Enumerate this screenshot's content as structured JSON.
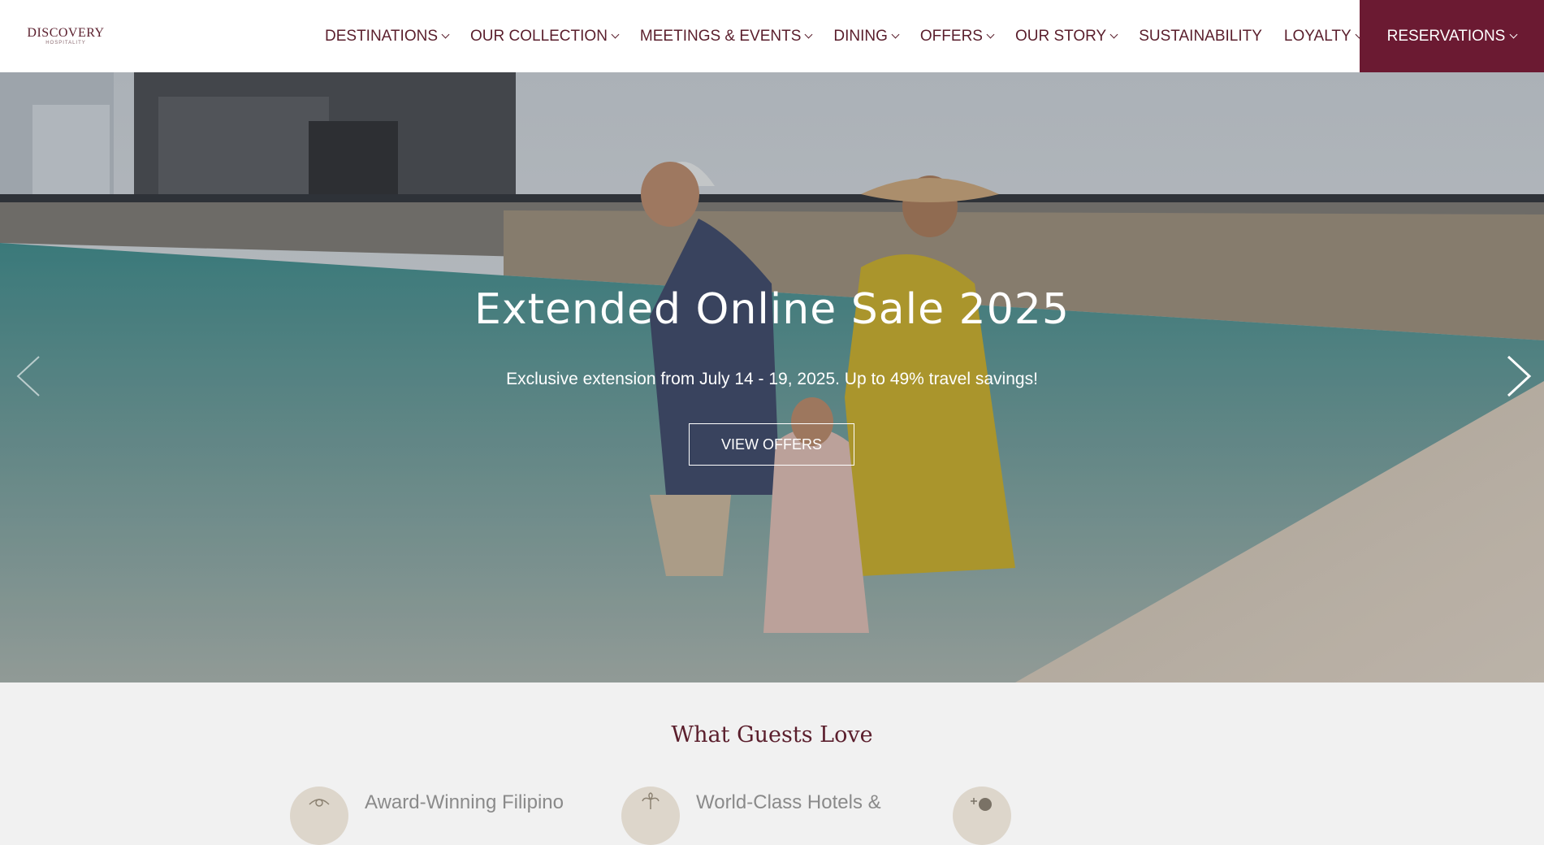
{
  "header": {
    "logo": {
      "main": "DISCOVERY",
      "sub": "HOSPITALITY"
    },
    "nav": [
      {
        "label": "DESTINATIONS",
        "dropdown": true
      },
      {
        "label": "OUR COLLECTION",
        "dropdown": true
      },
      {
        "label": "MEETINGS & EVENTS",
        "dropdown": true
      },
      {
        "label": "DINING",
        "dropdown": true
      },
      {
        "label": "OFFERS",
        "dropdown": true
      },
      {
        "label": "OUR STORY",
        "dropdown": true
      },
      {
        "label": "SUSTAINABILITY",
        "dropdown": false
      },
      {
        "label": "LOYALTY",
        "dropdown": true
      }
    ],
    "reservations_label": "RESERVATIONS"
  },
  "hero": {
    "title": "Extended Online Sale 2025",
    "subtitle": "Exclusive extension from July 14 - 19, 2025. Up to 49% travel savings!",
    "cta_label": "VIEW OFFERS",
    "prev_icon": "chevron-left-icon",
    "next_icon": "chevron-right-icon"
  },
  "guests_love": {
    "title": "What Guests Love",
    "features": [
      {
        "label": "Award-Winning Filipino",
        "icon": "award-icon"
      },
      {
        "label": "World-Class Hotels &",
        "icon": "palm-icon"
      },
      {
        "label": "",
        "icon": "leisure-icon"
      }
    ]
  },
  "colors": {
    "brand": "#5a1e2c",
    "reservations_bg": "#6b1a32",
    "section_bg": "#f1f1f1",
    "icon_circle": "#ddd6cb"
  }
}
